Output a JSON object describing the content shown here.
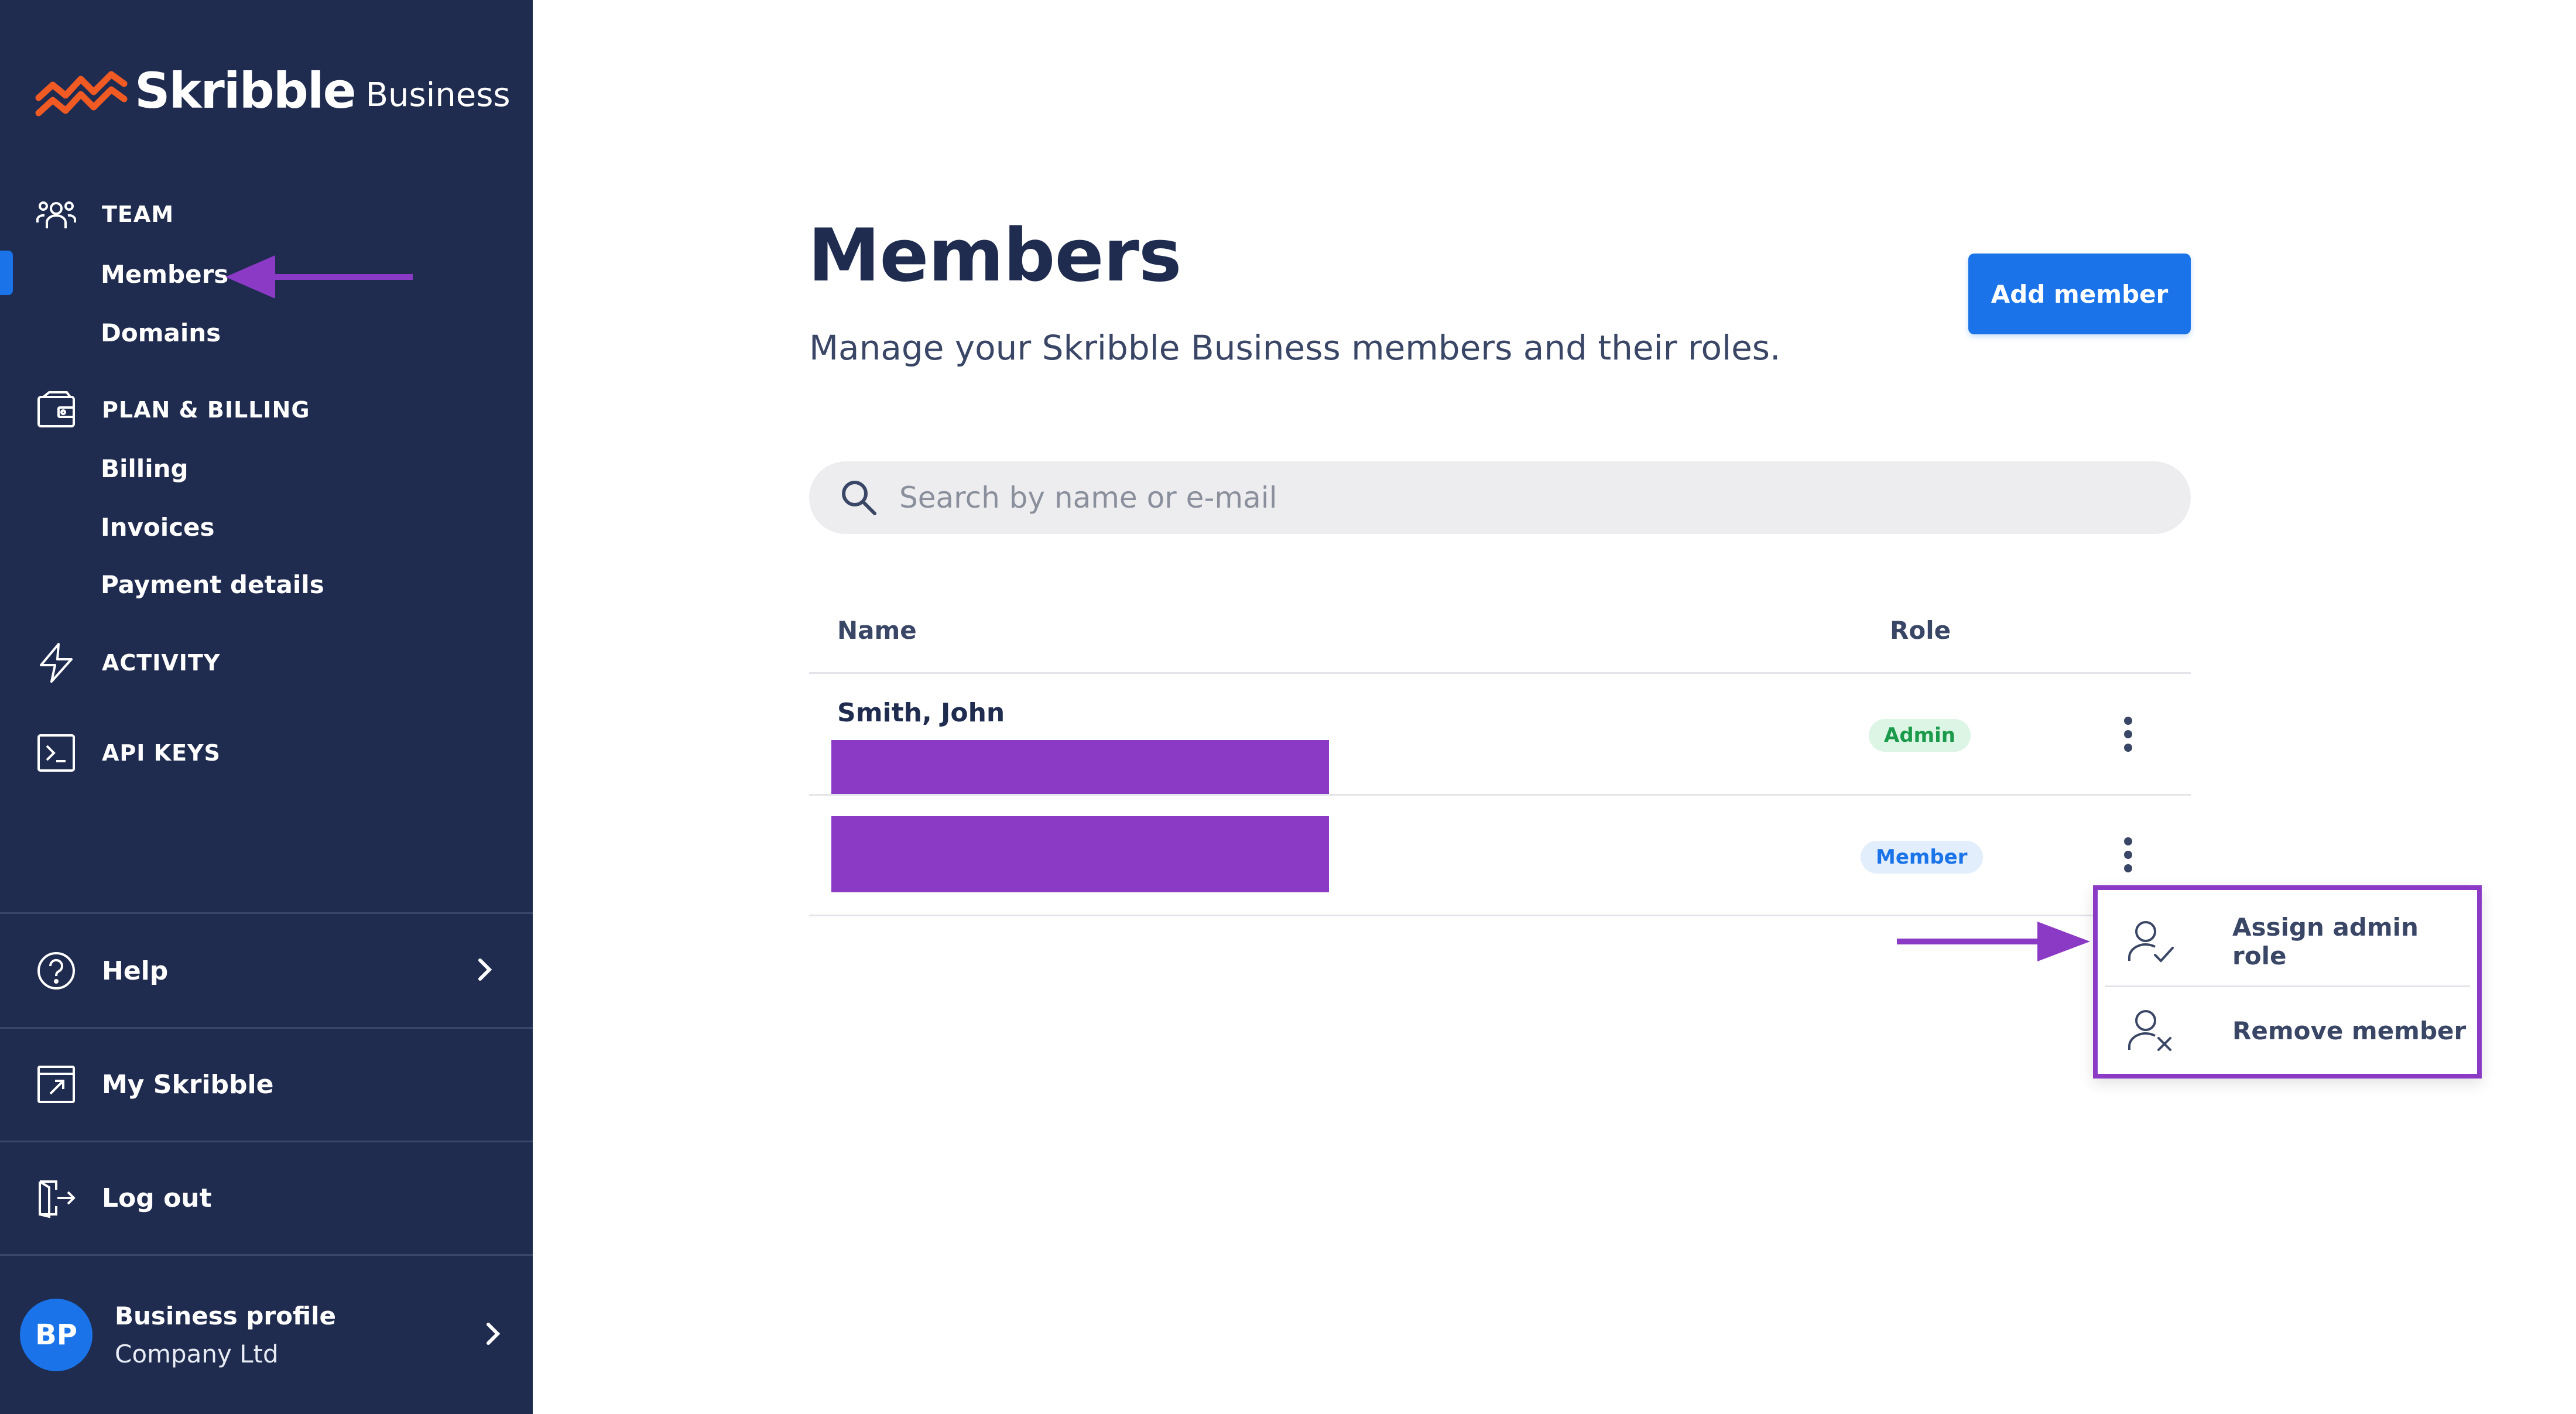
{
  "brand": {
    "name": "Skribble",
    "suffix": "Business",
    "accent": "#f25a24"
  },
  "sidebar": {
    "background": "#1f2c4f",
    "sections": [
      {
        "label": "TEAM",
        "icon": "team-icon"
      },
      {
        "label": "PLAN & BILLING",
        "icon": "wallet-icon"
      },
      {
        "label": "ACTIVITY",
        "icon": "lightning-icon"
      },
      {
        "label": "API KEYS",
        "icon": "terminal-icon"
      }
    ],
    "team_items": [
      "Members",
      "Domains"
    ],
    "billing_items": [
      "Billing",
      "Invoices",
      "Payment details"
    ],
    "active_item": "Members",
    "bottom": {
      "help": {
        "label": "Help",
        "icon": "help-circle-icon"
      },
      "my_skribble": {
        "label": "My Skribble",
        "icon": "external-link-icon"
      },
      "logout": {
        "label": "Log out",
        "icon": "logout-icon"
      }
    },
    "profile": {
      "initials": "BP",
      "name": "Business profile",
      "company": "Company Ltd"
    }
  },
  "main": {
    "title": "Members",
    "subtitle": "Manage your Skribble Business members and their roles.",
    "add_button": "Add member",
    "search": {
      "placeholder": "Search by name or e-mail",
      "icon": "search-icon"
    },
    "table": {
      "columns": [
        "Name",
        "Role"
      ],
      "rows": [
        {
          "name": "Smith, John",
          "role": "Admin"
        },
        {
          "name": "",
          "role": "Member"
        }
      ]
    },
    "context_menu": {
      "items": [
        {
          "label": "Assign admin role",
          "icon": "user-check-icon"
        },
        {
          "label": "Remove member",
          "icon": "user-remove-icon"
        }
      ]
    }
  },
  "annotation_color": "#8b3ac6",
  "primary_color": "#1a73e8"
}
